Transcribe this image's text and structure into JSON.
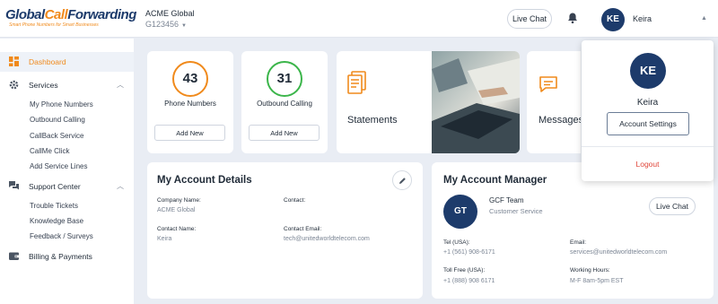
{
  "brand": {
    "logo_part1": "Global",
    "logo_part2": "Call",
    "logo_part3": "Forwarding",
    "tagline": "Smart Phone Numbers for Smart Businesses"
  },
  "header": {
    "account_name": "ACME Global",
    "account_id": "G123456",
    "live_chat_label": "Live Chat",
    "user_initials": "KE",
    "user_name": "Keira"
  },
  "sidebar": {
    "dashboard": "Dashboard",
    "services": "Services",
    "services_items": [
      "My Phone Numbers",
      "Outbound Calling",
      "CallBack Service",
      "CallMe Click",
      "Add Service Lines"
    ],
    "support": "Support Center",
    "support_items": [
      "Trouble Tickets",
      "Knowledge Base",
      "Feedback / Surveys"
    ],
    "billing": "Billing & Payments"
  },
  "stats": [
    {
      "value": "43",
      "label": "Phone Numbers",
      "button": "Add New",
      "color": "#f08a1c"
    },
    {
      "value": "31",
      "label": "Outbound Calling",
      "button": "Add New",
      "color": "#3bb54a"
    }
  ],
  "tiles": {
    "statements": "Statements",
    "messages": "Messages"
  },
  "account_details": {
    "title": "My Account Details",
    "company_label": "Company Name:",
    "company_value": "ACME Global",
    "contact_label": "Contact:",
    "contact_value": "",
    "contact_name_label": "Contact Name:",
    "contact_name_value": "Keira",
    "contact_email_label": "Contact Email:",
    "contact_email_value": "tech@unitedworldtelecom.com"
  },
  "account_manager": {
    "title": "My Account Manager",
    "initials": "GT",
    "team": "GCF Team",
    "role": "Customer Service",
    "live_chat_label": "Live Chat",
    "tel_label": "Tel (USA):",
    "tel_value": "+1 (561) 908-6171",
    "email_label": "Email:",
    "email_value": "services@unitedworldtelecom.com",
    "tollfree_label": "Toll Free (USA):",
    "tollfree_value": "+1 (888) 908 6171",
    "hours_label": "Working Hours:",
    "hours_value": "M-F 8am-5pm EST"
  },
  "user_menu": {
    "initials": "KE",
    "name": "Keira",
    "settings_label": "Account Settings",
    "logout_label": "Logout"
  },
  "colors": {
    "brand_navy": "#1d3b6b",
    "accent_orange": "#f08a1c",
    "accent_green": "#3bb54a",
    "logout_red": "#e0463a"
  }
}
